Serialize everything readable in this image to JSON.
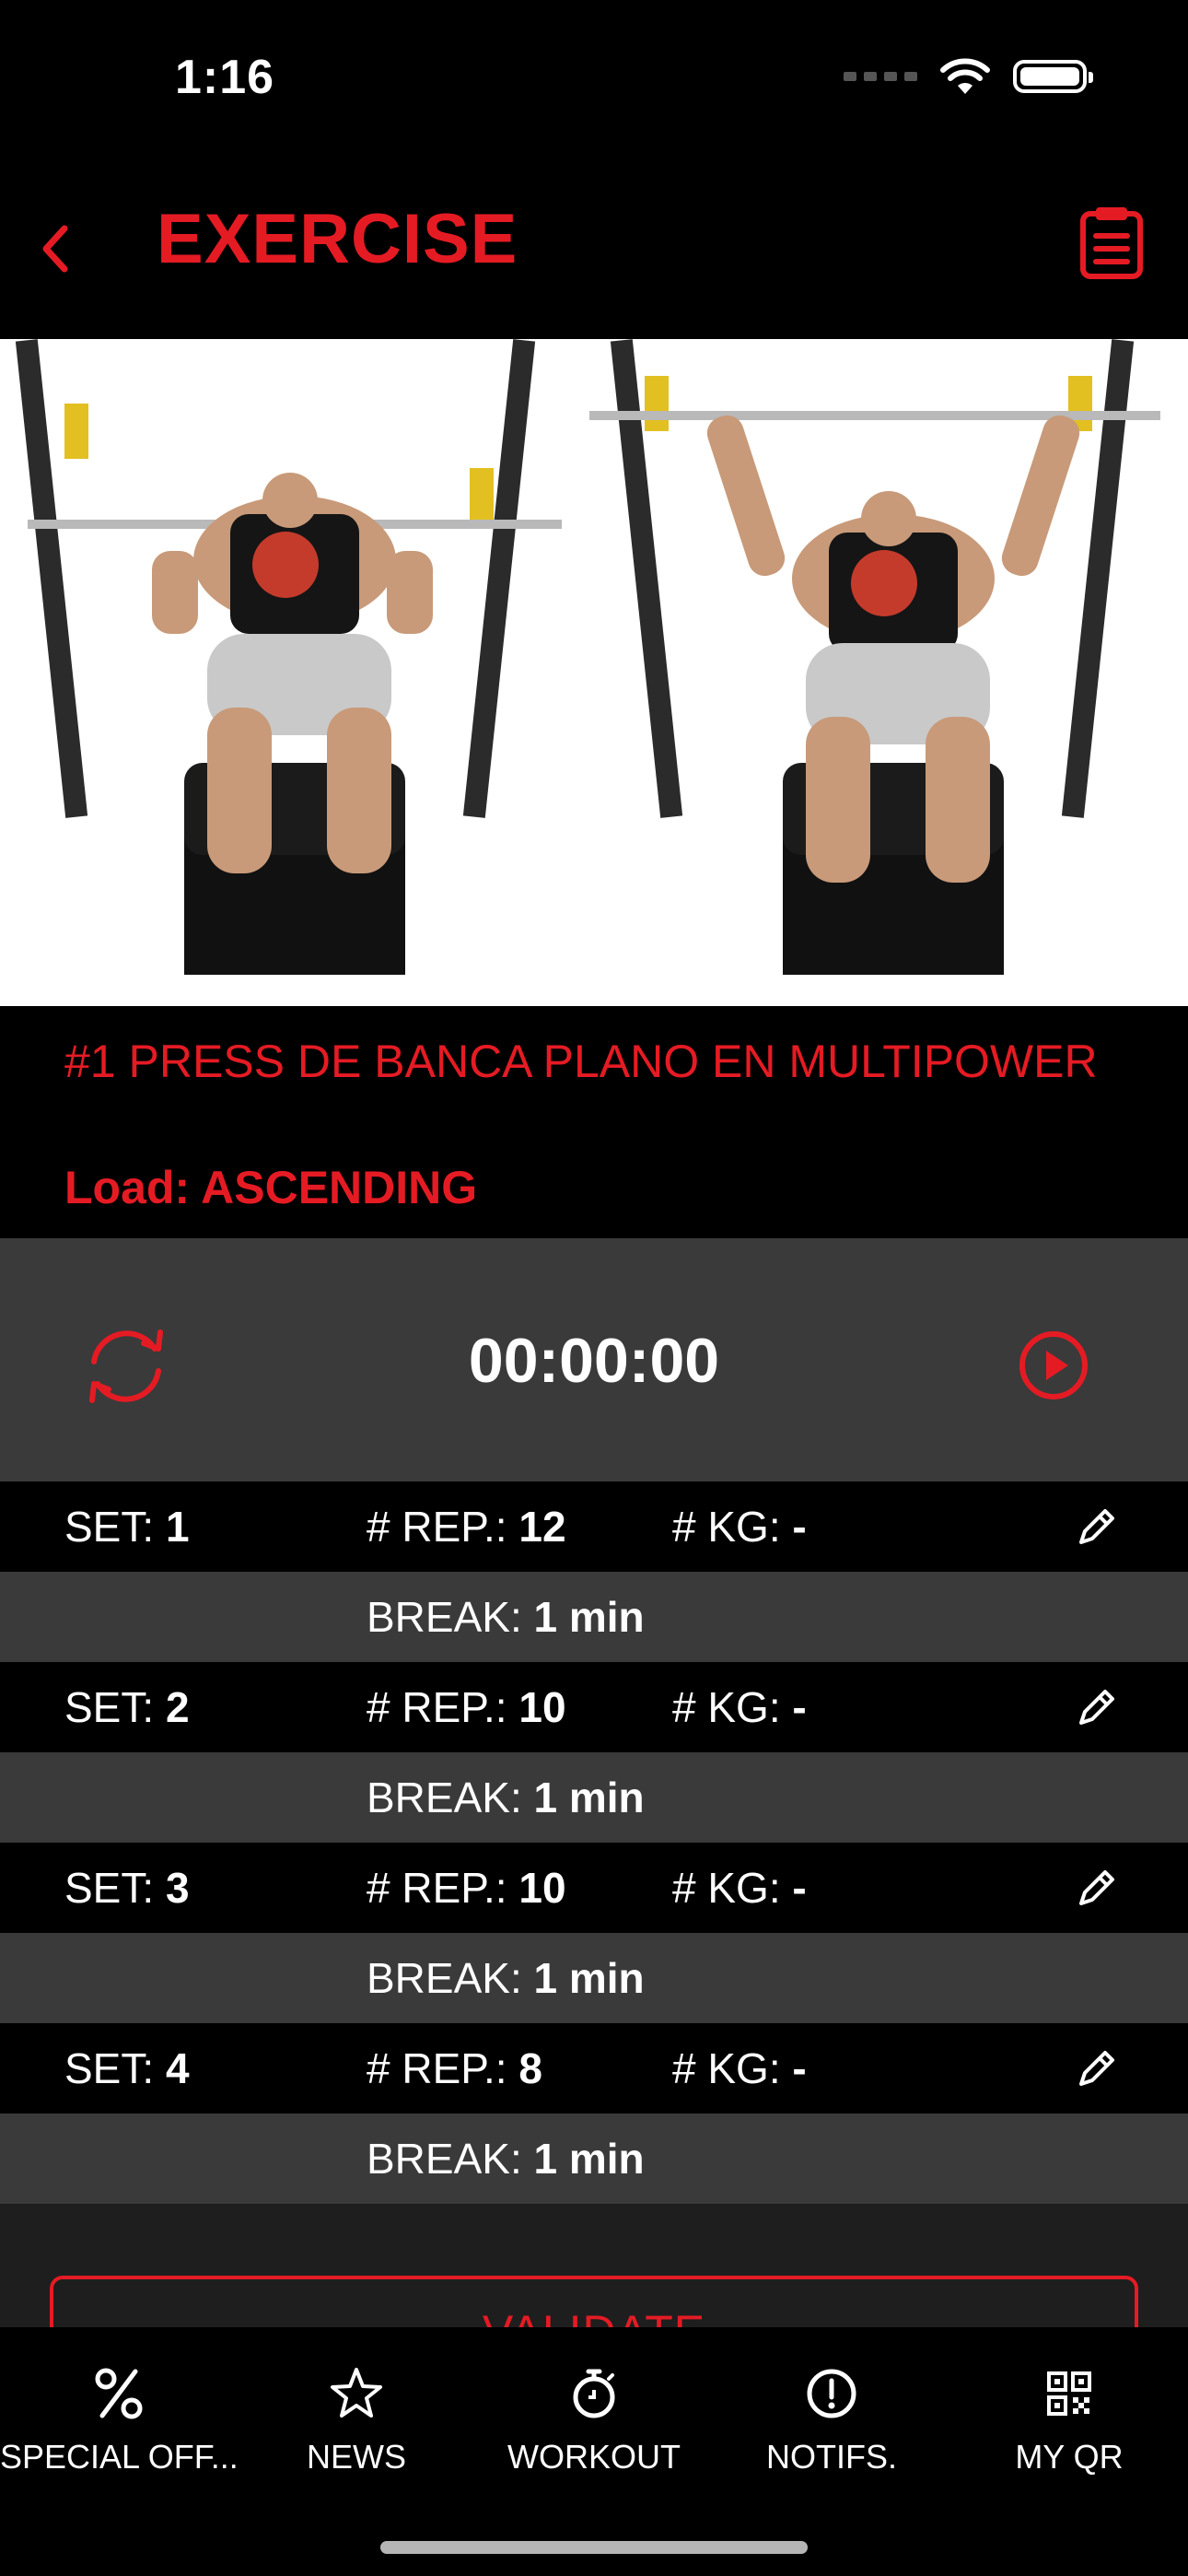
{
  "status_bar": {
    "time": "1:16"
  },
  "header": {
    "title": "EXERCISE"
  },
  "exercise": {
    "name": "#1 PRESS DE BANCA PLANO EN MULTIPOWER",
    "load_label": "Load:",
    "load_value": "ASCENDING"
  },
  "timer": {
    "value": "00:00:00"
  },
  "labels": {
    "set": "SET:",
    "rep": "# REP.:",
    "kg": "# KG:",
    "break": "BREAK:"
  },
  "sets": [
    {
      "set": "1",
      "reps": "12",
      "kg": "-",
      "break": "1 min"
    },
    {
      "set": "2",
      "reps": "10",
      "kg": "-",
      "break": "1 min"
    },
    {
      "set": "3",
      "reps": "10",
      "kg": "-",
      "break": "1 min"
    },
    {
      "set": "4",
      "reps": "8",
      "kg": "-",
      "break": "1 min"
    }
  ],
  "actions": {
    "validate": "VALIDATE"
  },
  "tabs": [
    {
      "label": "SPECIAL OFF...",
      "icon": "percent-icon"
    },
    {
      "label": "NEWS",
      "icon": "star-icon"
    },
    {
      "label": "WORKOUT",
      "icon": "stopwatch-icon"
    },
    {
      "label": "NOTIFS.",
      "icon": "alert-circle-icon"
    },
    {
      "label": "MY QR",
      "icon": "qr-code-icon"
    }
  ],
  "colors": {
    "accent": "#e51b24",
    "dark_bg": "#000000",
    "row_alt": "#3a3a3a",
    "page_bg": "#1e1e1e"
  }
}
